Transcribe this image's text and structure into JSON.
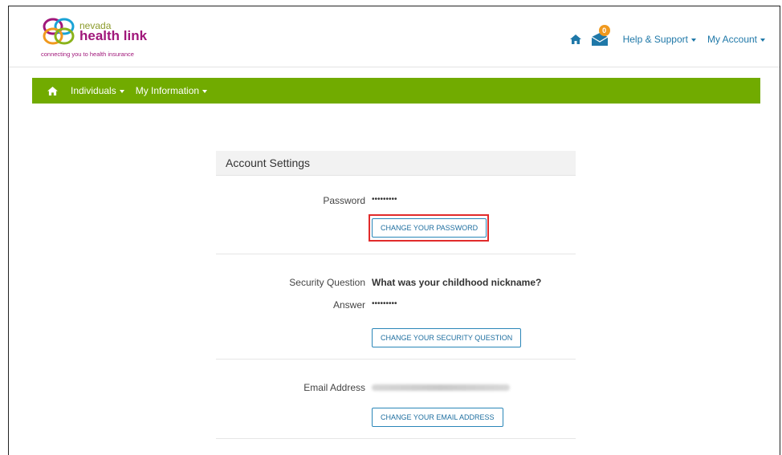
{
  "header": {
    "logo": {
      "small": "nevada",
      "big": "health link",
      "tagline": "connecting you to health insurance"
    },
    "inbox_count": "0",
    "help_label": "Help & Support",
    "account_label": "My Account"
  },
  "nav": {
    "items": [
      {
        "label": "Individuals"
      },
      {
        "label": "My Information"
      }
    ]
  },
  "settings": {
    "title": "Account Settings",
    "password_label": "Password",
    "password_value": "•••••••••",
    "change_password": "CHANGE YOUR PASSWORD",
    "security_label": "Security Question",
    "security_question": "What was your childhood nickname?",
    "answer_label": "Answer",
    "answer_value": "•••••••••",
    "change_security": "CHANGE YOUR SECURITY QUESTION",
    "email_label": "Email Address",
    "email_value": "",
    "change_email": "CHANGE YOUR EMAIL ADDRESS"
  },
  "colors": {
    "nav_green": "#71ab00",
    "link_blue": "#1f78a8",
    "badge_orange": "#f0991e",
    "logo_magenta": "#a0177a",
    "highlight_red": "#e12b2b"
  }
}
